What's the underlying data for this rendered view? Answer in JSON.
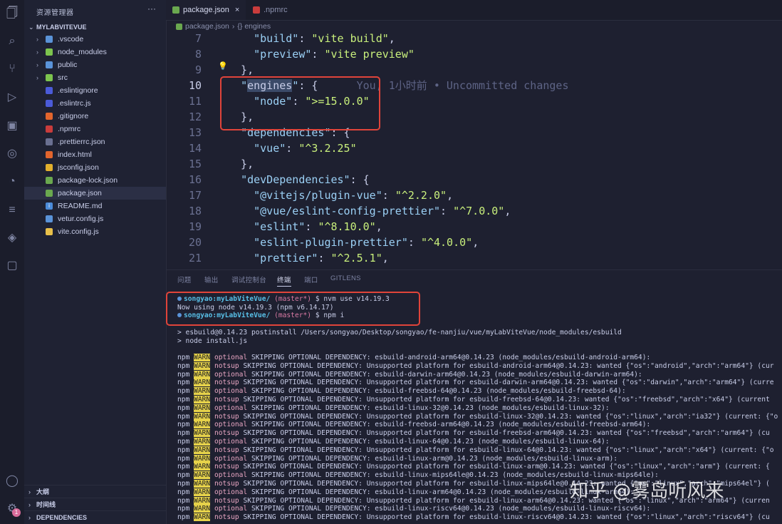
{
  "sidebar": {
    "title": "资源管理器",
    "more": "···",
    "folder": "MYLABVITEVUE",
    "items": [
      {
        "label": ".vscode",
        "chev": "›",
        "icon": "folder-icon",
        "color": "#5a93d8",
        "icon_text": ""
      },
      {
        "label": "node_modules",
        "chev": "›",
        "icon": "folder-icon",
        "color": "#7cc44e",
        "icon_text": ""
      },
      {
        "label": "public",
        "chev": "›",
        "icon": "folder-icon",
        "color": "#5a93d8",
        "icon_text": ""
      },
      {
        "label": "src",
        "chev": "›",
        "icon": "folder-icon",
        "color": "#7cc44e",
        "icon_text": ""
      },
      {
        "label": ".eslintignore",
        "chev": "",
        "icon": "eslint-icon",
        "color": "#4b5bd8",
        "icon_text": ""
      },
      {
        "label": ".eslintrc.js",
        "chev": "",
        "icon": "eslint-icon",
        "color": "#4b5bd8",
        "icon_text": ""
      },
      {
        "label": ".gitignore",
        "chev": "",
        "icon": "git-icon",
        "color": "#e2652d",
        "icon_text": ""
      },
      {
        "label": ".npmrc",
        "chev": "",
        "icon": "npm-icon",
        "color": "#c93c3c",
        "icon_text": ""
      },
      {
        "label": ".prettierrc.json",
        "chev": "",
        "icon": "prettier-icon",
        "color": "#6a7091",
        "icon_text": ""
      },
      {
        "label": "index.html",
        "chev": "",
        "icon": "html-icon",
        "color": "#e2652d",
        "icon_text": ""
      },
      {
        "label": "jsconfig.json",
        "chev": "",
        "icon": "json-icon",
        "color": "#e2b02d",
        "icon_text": ""
      },
      {
        "label": "package-lock.json",
        "chev": "",
        "icon": "nodejs-icon",
        "color": "#6aa84f",
        "icon_text": ""
      },
      {
        "label": "package.json",
        "chev": "",
        "icon": "nodejs-icon",
        "color": "#6aa84f",
        "icon_text": ""
      },
      {
        "label": "README.md",
        "chev": "",
        "icon": "info-icon",
        "color": "#4b8bd8",
        "icon_text": "i"
      },
      {
        "label": "vetur.config.js",
        "chev": "",
        "icon": "vetur-icon",
        "color": "#5a93d8",
        "icon_text": ""
      },
      {
        "label": "vite.config.js",
        "chev": "",
        "icon": "vite-icon",
        "color": "#e8c04a",
        "icon_text": ""
      }
    ],
    "bottom": [
      {
        "label": "大纲"
      },
      {
        "label": "时间线"
      },
      {
        "label": "DEPENDENCIES"
      }
    ]
  },
  "tabs": [
    {
      "label": "package.json",
      "close": "×",
      "icon": "nodejs-icon"
    },
    {
      "label": ".npmrc",
      "icon": "npm-icon"
    }
  ],
  "breadcrumb": {
    "file": "package.json",
    "sep": "›",
    "symbol": "{} engines"
  },
  "editor": {
    "lines": [
      {
        "n": "7",
        "parts": [
          [
            "p",
            "    "
          ],
          [
            "k",
            "\"build\""
          ],
          [
            "p",
            ": "
          ],
          [
            "s",
            "\"vite build\""
          ],
          [
            "p",
            ","
          ]
        ]
      },
      {
        "n": "8",
        "parts": [
          [
            "p",
            "    "
          ],
          [
            "k",
            "\"preview\""
          ],
          [
            "p",
            ": "
          ],
          [
            "s",
            "\"vite preview\""
          ]
        ]
      },
      {
        "n": "9",
        "parts": [
          [
            "p",
            "  },"
          ]
        ]
      },
      {
        "n": "10",
        "cur": true,
        "parts": [
          [
            "p",
            "  "
          ],
          [
            "k",
            "\""
          ],
          [
            "hl",
            "engines"
          ],
          [
            "k",
            "\""
          ],
          [
            "p",
            ": {"
          ],
          [
            "blame",
            "      You, 1小时前 • Uncommitted changes"
          ]
        ]
      },
      {
        "n": "11",
        "parts": [
          [
            "p",
            "    "
          ],
          [
            "k",
            "\"node\""
          ],
          [
            "p",
            ": "
          ],
          [
            "s",
            "\">=15.0.0\""
          ]
        ]
      },
      {
        "n": "12",
        "parts": [
          [
            "p",
            "  },"
          ]
        ]
      },
      {
        "n": "13",
        "parts": [
          [
            "p",
            "  "
          ],
          [
            "k",
            "\"dependencies\""
          ],
          [
            "p",
            ": {"
          ]
        ]
      },
      {
        "n": "14",
        "parts": [
          [
            "p",
            "    "
          ],
          [
            "k",
            "\"vue\""
          ],
          [
            "p",
            ": "
          ],
          [
            "s",
            "\"^3.2.25\""
          ]
        ]
      },
      {
        "n": "15",
        "parts": [
          [
            "p",
            "  },"
          ]
        ]
      },
      {
        "n": "16",
        "parts": [
          [
            "p",
            "  "
          ],
          [
            "k",
            "\"devDependencies\""
          ],
          [
            "p",
            ": {"
          ]
        ]
      },
      {
        "n": "17",
        "parts": [
          [
            "p",
            "    "
          ],
          [
            "k",
            "\"@vitejs/plugin-vue\""
          ],
          [
            "p",
            ": "
          ],
          [
            "s",
            "\"^2.2.0\""
          ],
          [
            "p",
            ","
          ]
        ]
      },
      {
        "n": "18",
        "parts": [
          [
            "p",
            "    "
          ],
          [
            "k",
            "\"@vue/eslint-config-prettier\""
          ],
          [
            "p",
            ": "
          ],
          [
            "s",
            "\"^7.0.0\""
          ],
          [
            "p",
            ","
          ]
        ]
      },
      {
        "n": "19",
        "parts": [
          [
            "p",
            "    "
          ],
          [
            "k",
            "\"eslint\""
          ],
          [
            "p",
            ": "
          ],
          [
            "s",
            "\"^8.10.0\""
          ],
          [
            "p",
            ","
          ]
        ]
      },
      {
        "n": "20",
        "parts": [
          [
            "p",
            "    "
          ],
          [
            "k",
            "\"eslint-plugin-prettier\""
          ],
          [
            "p",
            ": "
          ],
          [
            "s",
            "\"^4.0.0\""
          ],
          [
            "p",
            ","
          ]
        ]
      },
      {
        "n": "21",
        "parts": [
          [
            "p",
            "    "
          ],
          [
            "k",
            "\"prettier\""
          ],
          [
            "p",
            ": "
          ],
          [
            "s",
            "\"^2.5.1\""
          ],
          [
            "p",
            ","
          ]
        ]
      }
    ]
  },
  "panel_tabs": [
    "问题",
    "输出",
    "调试控制台",
    "终端",
    "端口",
    "GITLENS"
  ],
  "panel_active": "终端",
  "terminal": {
    "prompt_user": "songyao:myLabViteVue/",
    "prompt_branch": "(master*)",
    "prompt_sym": "$",
    "cmd1": "nvm use v14.19.3",
    "out1": "Now using node v14.19.3 (npm v6.14.17)",
    "cmd2": "npm i",
    "post1": "> esbuild@0.14.23 postinstall /Users/songyao/Desktop/songyao/fe-nanjiu/vue/myLabViteVue/node_modules/esbuild",
    "post2": "> node install.js",
    "npm": "npm",
    "warn": "WARN",
    "warn_lines": [
      [
        "optional",
        "SKIPPING OPTIONAL DEPENDENCY: esbuild-android-arm64@0.14.23 (node_modules/esbuild-android-arm64):"
      ],
      [
        "notsup",
        "SKIPPING OPTIONAL DEPENDENCY: Unsupported platform for esbuild-android-arm64@0.14.23: wanted {\"os\":\"android\",\"arch\":\"arm64\"} (cur"
      ],
      [
        "optional",
        "SKIPPING OPTIONAL DEPENDENCY: esbuild-darwin-arm64@0.14.23 (node_modules/esbuild-darwin-arm64):"
      ],
      [
        "notsup",
        "SKIPPING OPTIONAL DEPENDENCY: Unsupported platform for esbuild-darwin-arm64@0.14.23: wanted {\"os\":\"darwin\",\"arch\":\"arm64\"} (curre"
      ],
      [
        "optional",
        "SKIPPING OPTIONAL DEPENDENCY: esbuild-freebsd-64@0.14.23 (node_modules/esbuild-freebsd-64):"
      ],
      [
        "notsup",
        "SKIPPING OPTIONAL DEPENDENCY: Unsupported platform for esbuild-freebsd-64@0.14.23: wanted {\"os\":\"freebsd\",\"arch\":\"x64\"} (current"
      ],
      [
        "optional",
        "SKIPPING OPTIONAL DEPENDENCY: esbuild-linux-32@0.14.23 (node_modules/esbuild-linux-32):"
      ],
      [
        "notsup",
        "SKIPPING OPTIONAL DEPENDENCY: Unsupported platform for esbuild-linux-32@0.14.23: wanted {\"os\":\"linux\",\"arch\":\"ia32\"} (current: {\"o"
      ],
      [
        "optional",
        "SKIPPING OPTIONAL DEPENDENCY: esbuild-freebsd-arm64@0.14.23 (node_modules/esbuild-freebsd-arm64):"
      ],
      [
        "notsup",
        "SKIPPING OPTIONAL DEPENDENCY: Unsupported platform for esbuild-freebsd-arm64@0.14.23: wanted {\"os\":\"freebsd\",\"arch\":\"arm64\"} (cu"
      ],
      [
        "optional",
        "SKIPPING OPTIONAL DEPENDENCY: esbuild-linux-64@0.14.23 (node_modules/esbuild-linux-64):"
      ],
      [
        "notsup",
        "SKIPPING OPTIONAL DEPENDENCY: Unsupported platform for esbuild-linux-64@0.14.23: wanted {\"os\":\"linux\",\"arch\":\"x64\"} (current: {\"o"
      ],
      [
        "optional",
        "SKIPPING OPTIONAL DEPENDENCY: esbuild-linux-arm@0.14.23 (node_modules/esbuild-linux-arm):"
      ],
      [
        "notsup",
        "SKIPPING OPTIONAL DEPENDENCY: Unsupported platform for esbuild-linux-arm@0.14.23: wanted {\"os\":\"linux\",\"arch\":\"arm\"} (current: {"
      ],
      [
        "optional",
        "SKIPPING OPTIONAL DEPENDENCY: esbuild-linux-mips64le@0.14.23 (node_modules/esbuild-linux-mips64le):"
      ],
      [
        "notsup",
        "SKIPPING OPTIONAL DEPENDENCY: Unsupported platform for esbuild-linux-mips64le@0.14.23: wanted {\"os\":\"linux\",\"arch\":\"mips64el\"} ("
      ],
      [
        "optional",
        "SKIPPING OPTIONAL DEPENDENCY: esbuild-linux-arm64@0.14.23 (node_modules/esbuild-linux-arm64):"
      ],
      [
        "notsup",
        "SKIPPING OPTIONAL DEPENDENCY: Unsupported platform for esbuild-linux-arm64@0.14.23: wanted {\"os\":\"linux\",\"arch\":\"arm64\"} (curren"
      ],
      [
        "optional",
        "SKIPPING OPTIONAL DEPENDENCY: esbuild-linux-riscv64@0.14.23 (node_modules/esbuild-linux-riscv64):"
      ],
      [
        "notsup",
        "SKIPPING OPTIONAL DEPENDENCY: Unsupported platform for esbuild-linux-riscv64@0.14.23: wanted {\"os\":\"linux\",\"arch\":\"riscv64\"} (cu"
      ]
    ]
  },
  "watermark": "知乎 @雾岛听风来",
  "activity_badge": "1",
  "colors": {
    "accent": "#5a93d8",
    "highlight_box": "#e0443a",
    "warn_bg": "#e6d24a"
  }
}
